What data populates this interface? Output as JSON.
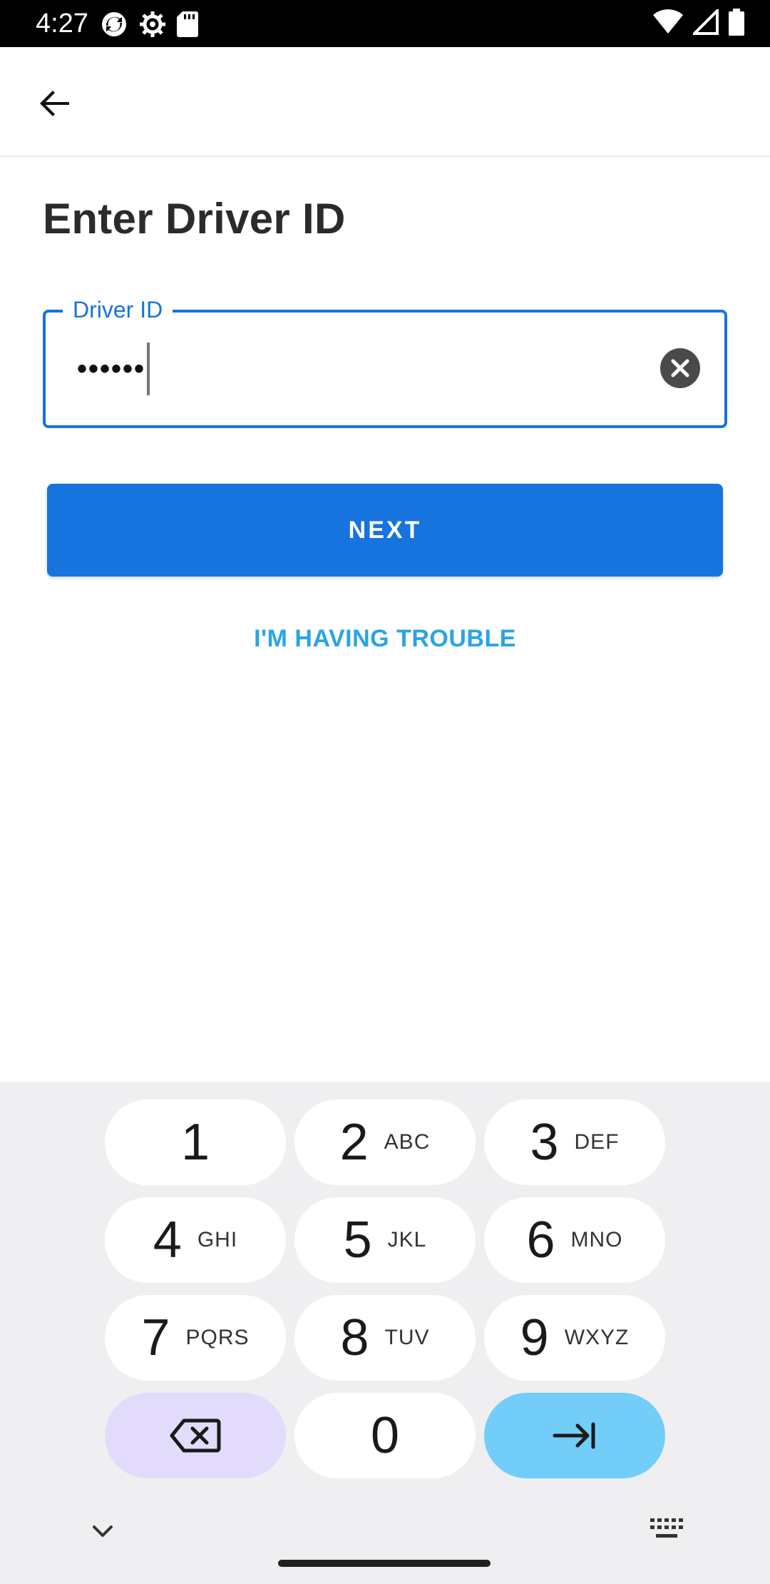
{
  "status_bar": {
    "time": "4:27",
    "left_icons": [
      "sync-icon",
      "settings-gear-icon",
      "sd-card-icon"
    ],
    "right_icons": [
      "wifi-icon",
      "signal-icon",
      "battery-icon"
    ]
  },
  "app_bar": {
    "back_icon": "arrow-back-icon"
  },
  "page": {
    "title": "Enter Driver ID"
  },
  "driver_field": {
    "label": "Driver ID",
    "value": "••••••",
    "clear_icon": "clear-circle-icon"
  },
  "buttons": {
    "next_label": "NEXT",
    "trouble_label": "I'M HAVING TROUBLE"
  },
  "keyboard": {
    "keys": [
      {
        "digit": "1",
        "letters": ""
      },
      {
        "digit": "2",
        "letters": "ABC"
      },
      {
        "digit": "3",
        "letters": "DEF"
      },
      {
        "digit": "4",
        "letters": "GHI"
      },
      {
        "digit": "5",
        "letters": "JKL"
      },
      {
        "digit": "6",
        "letters": "MNO"
      },
      {
        "digit": "7",
        "letters": "PQRS"
      },
      {
        "digit": "8",
        "letters": "TUV"
      },
      {
        "digit": "9",
        "letters": "WXYZ"
      },
      {
        "digit": "0",
        "letters": ""
      }
    ],
    "backspace_icon": "backspace-icon",
    "next_icon": "tab-next-icon",
    "collapse_icon": "chevron-down-icon",
    "switch_icon": "keyboard-icon"
  },
  "colors": {
    "primary": "#1773de",
    "link": "#2aa4e4",
    "backspace_key": "#e2dbfb",
    "next_key": "#72cdf9",
    "keyboard_bg": "#efeff2"
  }
}
